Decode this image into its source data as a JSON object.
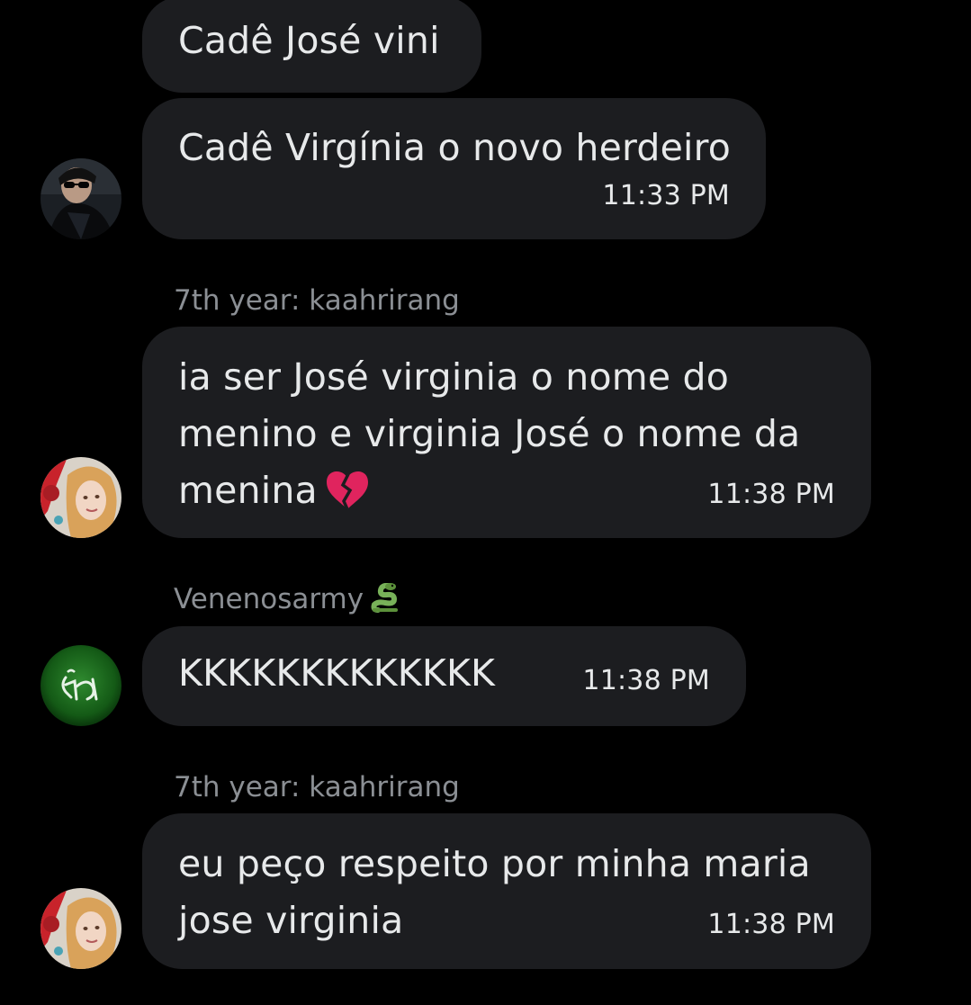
{
  "messages": [
    {
      "text_lines": [
        "Cadê José vini"
      ],
      "time": ""
    },
    {
      "text_lines": [
        "Cadê Virgínia o novo herdeiro"
      ],
      "time": "11:33 PM",
      "avatar": "user-dark-sunglasses-avatar"
    },
    {
      "sender": "7th year: kaahrirang",
      "text_lines": [
        "ia ser José virginia o nome do",
        "menino e virginia José o nome da",
        "menina"
      ],
      "emoji": "broken-heart-icon",
      "time": "11:38 PM",
      "avatar": "user-blonde-red-avatar"
    },
    {
      "sender": "Venenosarmy",
      "sender_emoji": "snake-icon",
      "text_lines": [
        "KKKKKKKKKKKKK"
      ],
      "time": "11:38 PM",
      "avatar": "user-green-logo-avatar"
    },
    {
      "sender": "7th year: kaahrirang",
      "text_lines": [
        "eu peço respeito por minha maria",
        "jose virginia"
      ],
      "time": "11:38 PM",
      "avatar": "user-blonde-red-avatar"
    }
  ],
  "colors": {
    "background": "#000000",
    "bubble": "#1c1d20",
    "text": "#e7e9ea",
    "sender": "#8b8f94"
  }
}
